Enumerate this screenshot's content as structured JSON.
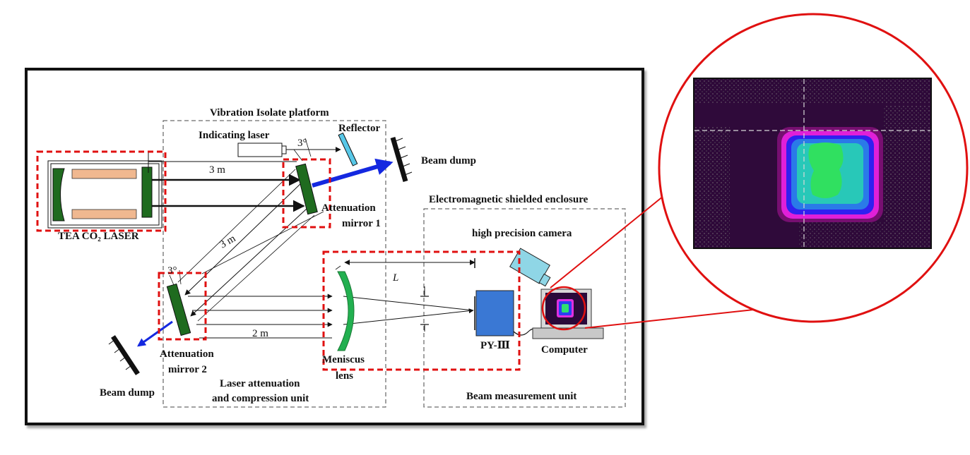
{
  "diagram": {
    "labels": {
      "vibration_platform": "Vibration Isolate platform",
      "indicating_laser": "Indicating laser",
      "reflector": "Reflector",
      "beam_dump_top": "Beam dump",
      "beam_dump_bottom": "Beam dump",
      "laser_source": "TEA CO₂ LASER",
      "distance_3m_a": "3 m",
      "distance_3m_b": "3 m",
      "distance_2m": "2 m",
      "angle_top": "3°",
      "angle_bottom": "3°",
      "att_mirror1_line1": "Attenuation",
      "att_mirror1_line2": "mirror 1",
      "att_mirror2_line1": "Attenuation",
      "att_mirror2_line2": "mirror 2",
      "em_enclosure": "Electromagnetic shielded enclosure",
      "camera": "high precision camera",
      "distance_L": "L",
      "detector": "PY-Ⅲ",
      "computer": "Computer",
      "meniscus_line1": "Meniscus",
      "meniscus_line2": "lens",
      "laser_unit_line1": "Laser attenuation",
      "laser_unit_line2": "and compression unit",
      "beam_unit": "Beam measurement unit"
    },
    "colors": {
      "highlight": "#e01010",
      "mirror_green": "#1f6b1f",
      "lens_green": "#22b050",
      "beam_blue": "#1428e0",
      "detector_blue": "#3a78d4",
      "camera_cyan": "#8fd6e6",
      "reflector_cyan": "#58c8e8"
    }
  }
}
